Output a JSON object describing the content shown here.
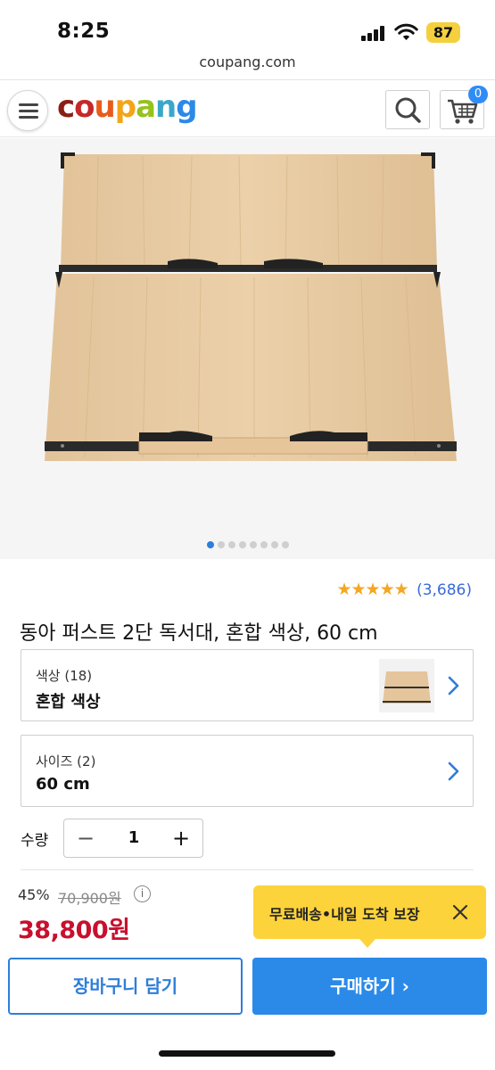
{
  "status_bar": {
    "time": "8:25",
    "battery": "87"
  },
  "browser": {
    "url": "coupang.com"
  },
  "header": {
    "logo_letters": [
      {
        "char": "c",
        "color": "#8b1e14"
      },
      {
        "char": "o",
        "color": "#c62828"
      },
      {
        "char": "u",
        "color": "#e85c1b"
      },
      {
        "char": "p",
        "color": "#f2a51a"
      },
      {
        "char": "a",
        "color": "#96c21e"
      },
      {
        "char": "n",
        "color": "#3aa7c9"
      },
      {
        "char": "g",
        "color": "#2b8ae8"
      }
    ],
    "cart_count": "0",
    "icons": [
      "menu-icon",
      "search-icon",
      "cart-icon"
    ]
  },
  "gallery": {
    "image_count": 8,
    "active_index": 0
  },
  "rating": {
    "stars": 5,
    "count_text": "(3,686)"
  },
  "product": {
    "title": "동아 퍼스트 2단 독서대, 혼합 색상, 60 cm"
  },
  "options": {
    "color": {
      "label": "색상 (18)",
      "value": "혼합 색상"
    },
    "size": {
      "label": "사이즈 (2)",
      "value": "60 cm"
    }
  },
  "quantity": {
    "label": "수량",
    "value": "1",
    "minus": "−",
    "plus": "+"
  },
  "price": {
    "discount": "45%",
    "original": "70,900원",
    "sale": "38,800원",
    "sale_color": "#c8102e"
  },
  "tooltip": {
    "text": "무료배송•내일 도착 보장",
    "color": "#fdd33b"
  },
  "actions": {
    "add_to_cart": "장바구니 담기",
    "buy_now": "구매하기 ›",
    "accent": "#2b8ae8"
  }
}
